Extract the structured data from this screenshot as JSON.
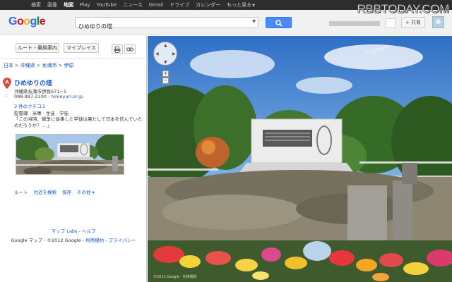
{
  "topbar": {
    "items": [
      "検索",
      "画像",
      "地図",
      "Play",
      "YouTube",
      "ニュース",
      "Gmail",
      "ドライブ",
      "カレンダー",
      "もっと見る"
    ],
    "active_index": 2
  },
  "watermark": "RBBTODAY.COM",
  "header": {
    "logo": "Google",
    "logo_colors": [
      "#3369e8",
      "#d50f25",
      "#eeb211",
      "#3369e8",
      "#009925",
      "#d50f25"
    ],
    "search_value": "ひめゆりの塔",
    "share_label": "+ 共有"
  },
  "panel": {
    "route_label": "ルート・乗換案内",
    "myplaces_label": "マイプレイス",
    "breadcrumb": [
      "日本",
      "沖縄県",
      "糸満市",
      "伊原"
    ],
    "place_title": "ひめゆりの塔",
    "address": "沖縄県糸満市伊原671−1",
    "phone": "098-997-2100",
    "website": "himeyuri.or.jp",
    "reviews_link": "3 件のクチコミ",
    "categories": "慰霊碑 · 米軍 · 生徒 · 学徒",
    "review_quote": "「この当時、戦争に従事した学徒は果たして日本を信んでいたのだろうか？",
    "review_more": "...」",
    "actions": [
      "ルート",
      "付近を検索",
      "保存",
      "その他 ▾"
    ],
    "footer_link1": "マップ Labs",
    "footer_sep": " - ",
    "footer_link2": "ヘルプ",
    "footer_text": "Google マップ - ©2012 Google - ",
    "footer_link3": "利用規約",
    "footer_link4": "プライバシー"
  },
  "streetview": {
    "image_watermark": "© Google",
    "copyright": "©2012 Google · 利用規約"
  }
}
